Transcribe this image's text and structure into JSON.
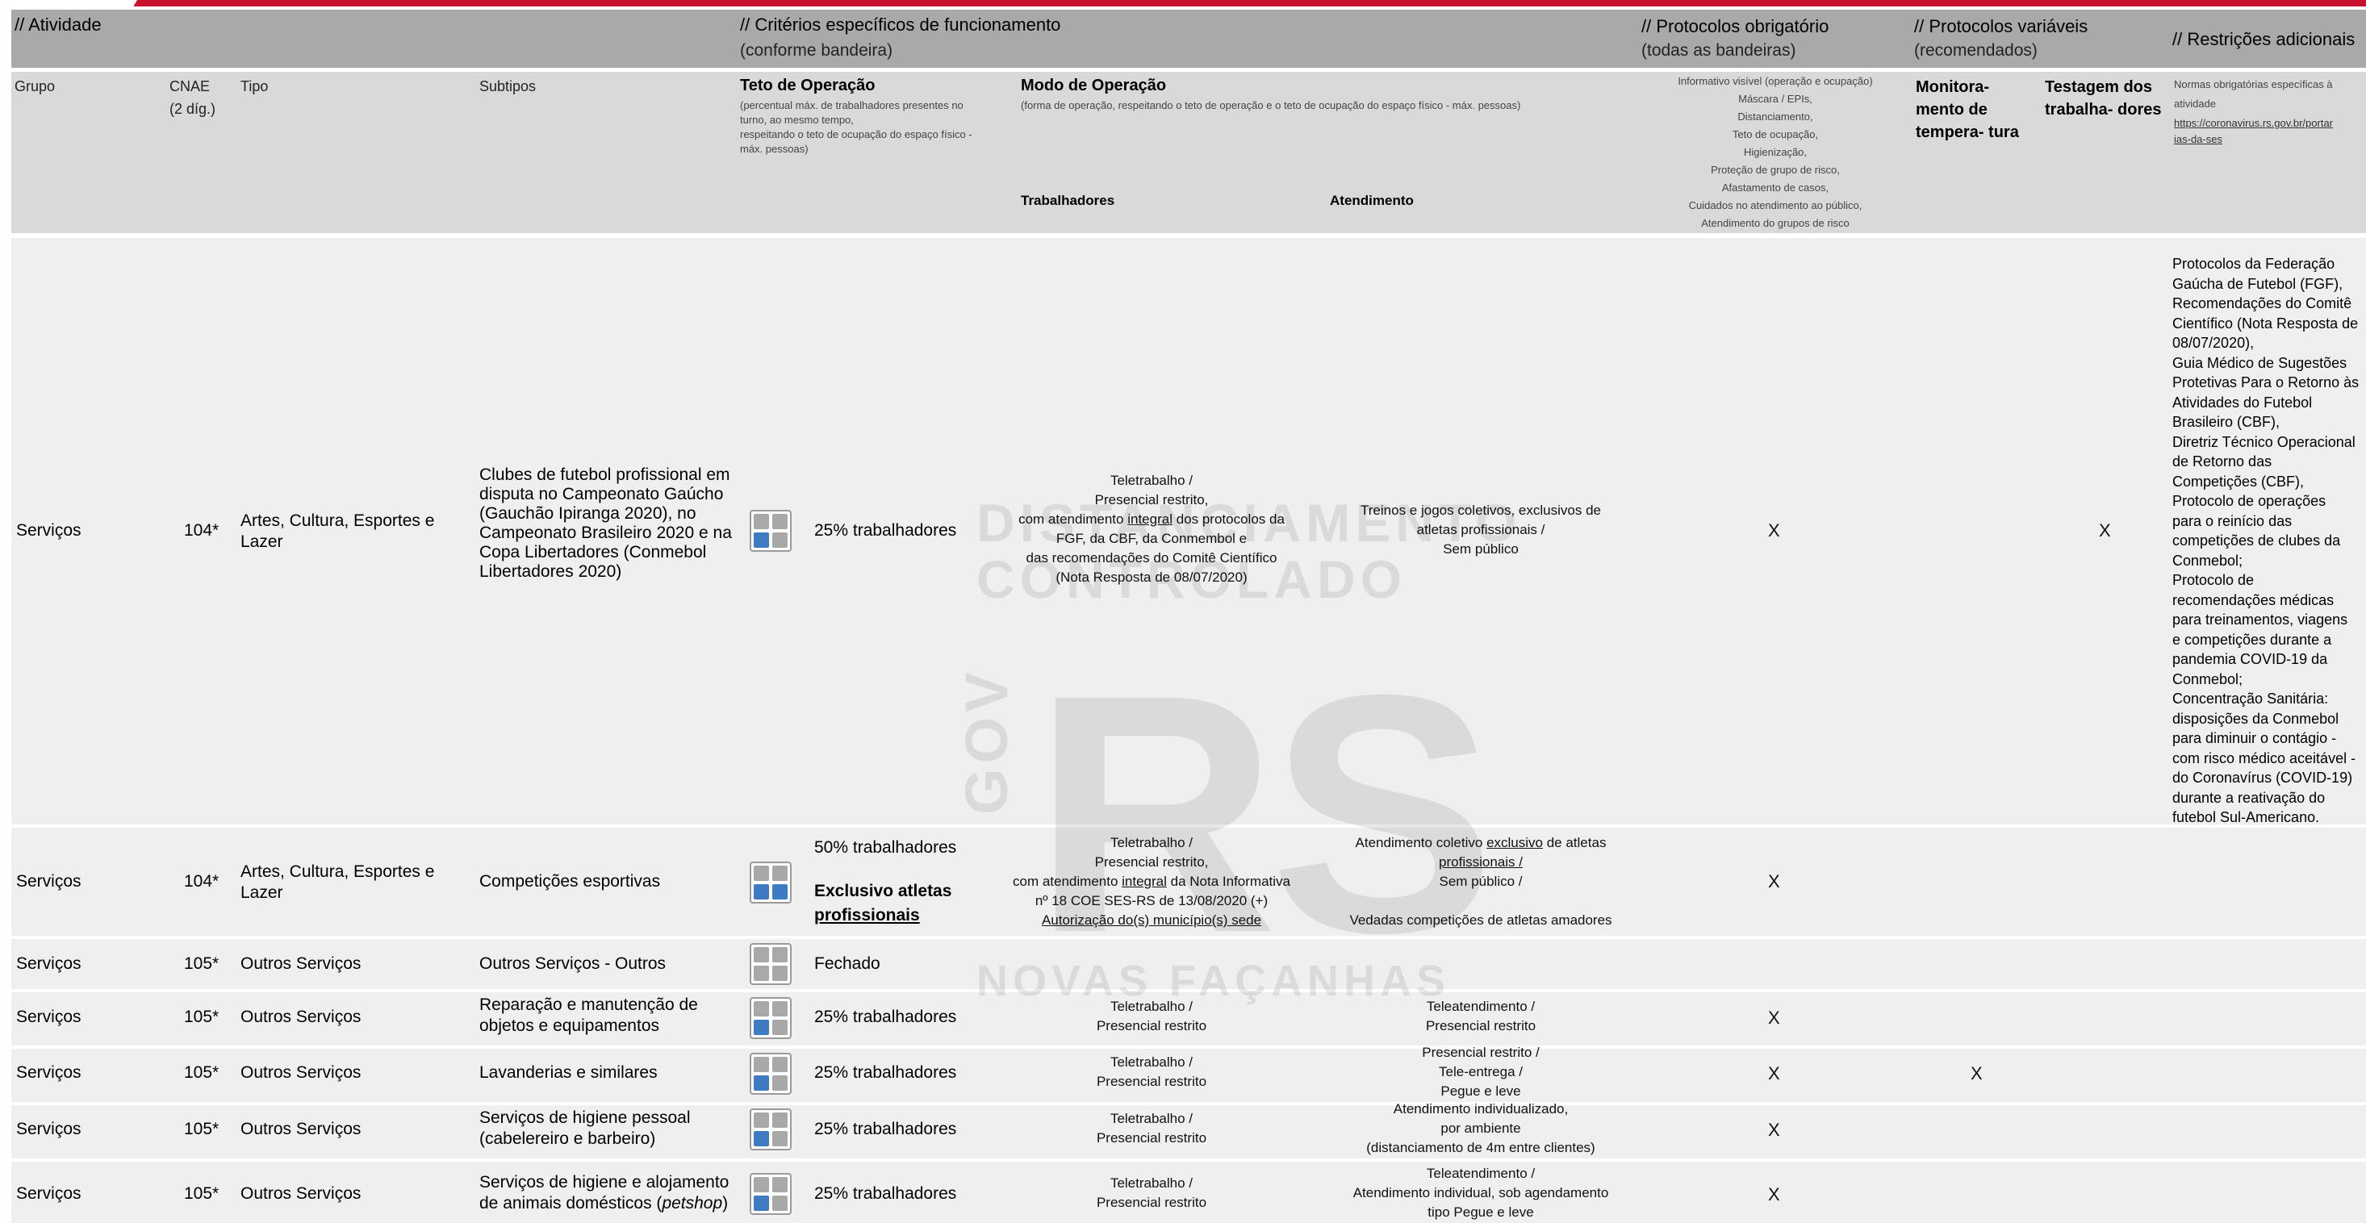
{
  "header": {
    "atividade": "// Atividade",
    "criterios": "// Critérios específicos de funcionamento",
    "criterios_sub": "(conforme bandeira)",
    "protocolos_obrig": "// Protocolos obrigatório",
    "protocolos_obrig_sub": "(todas as bandeiras)",
    "protocolos_var": "// Protocolos variáveis",
    "protocolos_var_sub": "(recomendados)",
    "restricoes": "// Restrições adicionais"
  },
  "subheader": {
    "grupo": "Grupo",
    "cnae": "CNAE",
    "cnae2": "(2 díg.)",
    "tipo": "Tipo",
    "subtipos": "Subtipos",
    "teto": "Teto de Operação",
    "teto_desc1": "(percentual máx. de trabalhadores presentes no",
    "teto_desc2": "turno, ao mesmo tempo,",
    "teto_desc3": "respeitando o teto de ocupação do espaço físico -",
    "teto_desc4": "máx. pessoas)",
    "modo": "Modo de Operação",
    "modo_desc": "(forma de operação, respeitando o teto de operação e o teto de ocupação do espaço físico - máx. pessoas)",
    "trabalhadores": "Trabalhadores",
    "atendimento": "Atendimento",
    "protocolos_list": [
      "Informativo visível (operação e ocupação)",
      "Máscara / EPIs,",
      "Distanciamento,",
      "Teto de ocupação,",
      "Higienização,",
      "Proteção de grupo de risco,",
      "Afastamento de casos,",
      "Cuidados no atendimento ao público,",
      "Atendimento do grupos de risco"
    ],
    "monitoramento1": "Monitora-",
    "monitoramento2": "mento de",
    "monitoramento3": "tempera- tura",
    "testagem1": "Testagem dos",
    "testagem2": "trabalha- dores",
    "normas1": "Normas obrigatórias específicas à",
    "normas2": "atividade",
    "normas_link1": "https://coronavirus.rs.gov.br/portar",
    "normas_link2": "ias-da-ses"
  },
  "watermark": {
    "line1": "DISTANCIAMENTO",
    "line2": "CONTROLADO",
    "gov": "GOV",
    "rs": "RS",
    "slogan": "NOVAS FAÇANHAS"
  },
  "rows": [
    {
      "grupo": "Serviços",
      "cnae": "104*",
      "tipo1": "Artes, Cultura, Esportes e",
      "tipo2": "Lazer",
      "subtipo": [
        "Clubes de futebol profissional em",
        "disputa no Campeonato Gaúcho",
        "(Gauchão Ipiranga 2020), no",
        "Campeonato Brasileiro 2020 e na",
        "Copa Libertadores (Conmebol",
        "Libertadores 2020)"
      ],
      "teto": "25% trabalhadores",
      "trab": [
        "Teletrabalho /",
        "Presencial restrito,",
        "com atendimento integral dos protocolos da",
        "FGF, da CBF, da Conmembol e",
        "das recomendações do Comitê Científico",
        "(Nota Resposta de 08/07/2020)"
      ],
      "atend": [
        "Treinos e jogos coletivos, exclusivos de",
        "atletas profissionais /",
        "Sem público"
      ],
      "obrig": "X",
      "testagem": "X",
      "restricoes": [
        "Protocolos da Federação",
        "Gaúcha de Futebol (FGF),",
        "Recomendações do Comitê",
        "Científico (Nota Resposta de",
        "08/07/2020),",
        "Guia Médico de Sugestões",
        "Protetivas Para o Retorno às",
        "Atividades do Futebol",
        "Brasileiro (CBF),",
        "Diretriz Técnico Operacional",
        "de Retorno das",
        "Competições (CBF),",
        "Protocolo de operações",
        "para o reinício das",
        "competições de clubes da",
        "Conmebol;",
        "Protocolo de",
        "recomendações médicas",
        "para treinamentos, viagens",
        "e competições durante a",
        "pandemia COVID-19 da",
        "Conmebol;",
        "Concentração Sanitária:",
        "disposições da Conmebol",
        "para diminuir o contágio -",
        "com risco médico aceitável -",
        "do Coronavírus (COVID-19)",
        "durante a reativação do",
        "futebol Sul-Americano."
      ]
    },
    {
      "grupo": "Serviços",
      "cnae": "104*",
      "tipo1": "Artes, Cultura, Esportes e",
      "tipo2": "Lazer",
      "subtipo": [
        "Competições esportivas"
      ],
      "teto": "50% trabalhadores",
      "teto_extra1": "Exclusivo atletas",
      "teto_extra2": "profissionais",
      "trab": [
        "Teletrabalho /",
        "Presencial restrito,",
        "com atendimento integral da Nota Informativa",
        "nº 18 COE SES-RS de 13/08/2020 (+)",
        "Autorização do(s) município(s) sede"
      ],
      "atend": [
        "Atendimento coletivo exclusivo de atletas",
        "profissionais /",
        "Sem público  /",
        "",
        "Vedadas competições de atletas amadores"
      ],
      "obrig": "X"
    },
    {
      "grupo": "Serviços",
      "cnae": "105*",
      "tipo1": "Outros Serviços",
      "subtipo": [
        "Outros Serviços - Outros"
      ],
      "teto": "Fechado"
    },
    {
      "grupo": "Serviços",
      "cnae": "105*",
      "tipo1": "Outros Serviços",
      "subtipo": [
        "Reparação e manutenção de",
        "objetos e equipamentos"
      ],
      "teto": "25% trabalhadores",
      "trab": [
        "Teletrabalho /",
        "Presencial restrito"
      ],
      "atend": [
        "Teleatendimento /",
        "Presencial restrito"
      ],
      "obrig": "X"
    },
    {
      "grupo": "Serviços",
      "cnae": "105*",
      "tipo1": "Outros Serviços",
      "subtipo": [
        "Lavanderias e similares"
      ],
      "teto": "25% trabalhadores",
      "trab": [
        "Teletrabalho /",
        "Presencial restrito"
      ],
      "atend": [
        "Presencial restrito /",
        "Tele-entrega /",
        "Pegue e leve"
      ],
      "obrig": "X",
      "monitoramento": "X"
    },
    {
      "grupo": "Serviços",
      "cnae": "105*",
      "tipo1": "Outros Serviços",
      "subtipo": [
        "Serviços de higiene pessoal",
        "(cabelereiro e barbeiro)"
      ],
      "teto": "25% trabalhadores",
      "trab": [
        "Teletrabalho /",
        "Presencial restrito"
      ],
      "atend": [
        "Atendimento individualizado,",
        "por ambiente",
        "(distanciamento de 4m entre clientes)"
      ],
      "obrig": "X"
    },
    {
      "grupo": "Serviços",
      "cnae": "105*",
      "tipo1": "Outros Serviços",
      "subtipo": [
        "Serviços de higiene e alojamento",
        "de animais domésticos (petshop)"
      ],
      "teto": "25% trabalhadores",
      "trab": [
        "Teletrabalho /",
        "Presencial restrito"
      ],
      "atend": [
        "Teleatendimento /",
        "Atendimento individual, sob agendamento",
        "tipo Pegue e leve"
      ],
      "obrig": "X"
    }
  ]
}
